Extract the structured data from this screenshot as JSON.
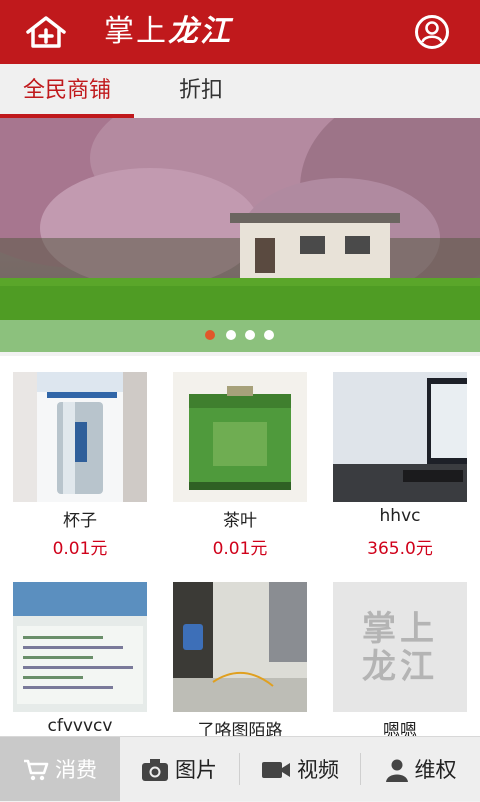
{
  "header": {
    "title_part1": "掌上",
    "title_part2": "龙江",
    "home_icon": "home-plus-icon",
    "user_icon": "user-circle-icon"
  },
  "tabs": [
    {
      "label": "全民商铺",
      "active": true
    },
    {
      "label": "折扣",
      "active": false
    }
  ],
  "banner": {
    "slides": 4,
    "active_slide": 1
  },
  "products": [
    {
      "name": "杯子",
      "price": "0.01元"
    },
    {
      "name": "茶叶",
      "price": "0.01元"
    },
    {
      "name": "hhvc",
      "price": "365.0元"
    },
    {
      "name": "cfvvvcv",
      "price": ""
    },
    {
      "name": "了咯图陌路",
      "price": ""
    },
    {
      "name": "嗯嗯",
      "price": ""
    }
  ],
  "placeholder_logo": {
    "line1": "掌上",
    "line2": "龙江"
  },
  "bottom_nav": [
    {
      "label": "消费",
      "icon": "cart-icon",
      "active": true
    },
    {
      "label": "图片",
      "icon": "camera-icon",
      "active": false
    },
    {
      "label": "视频",
      "icon": "video-camera-icon",
      "active": false
    },
    {
      "label": "维权",
      "icon": "person-icon",
      "active": false
    }
  ],
  "colors": {
    "brand_red": "#c0191c",
    "price_red": "#d0021b",
    "dot_active": "#e0582a"
  }
}
